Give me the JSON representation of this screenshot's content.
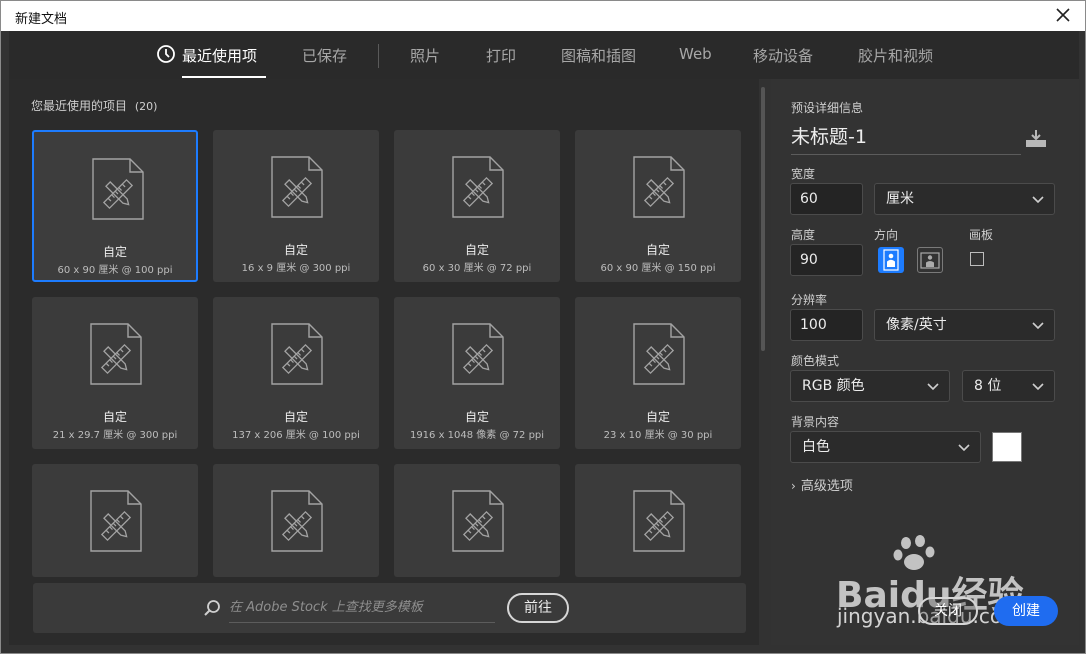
{
  "window": {
    "title": "新建文档"
  },
  "tabs": [
    {
      "label": "最近使用项",
      "active": true,
      "icon": "clock-icon"
    },
    {
      "label": "已保存"
    },
    {
      "label": "照片"
    },
    {
      "label": "打印"
    },
    {
      "label": "图稿和插图"
    },
    {
      "label": "Web"
    },
    {
      "label": "移动设备"
    },
    {
      "label": "胶片和视频"
    }
  ],
  "recent": {
    "label": "您最近使用的项目",
    "count": "(20)",
    "items": [
      {
        "name": "自定",
        "spec": "60 x 90 厘米 @ 100 ppi",
        "selected": true
      },
      {
        "name": "自定",
        "spec": "16 x 9 厘米 @ 300 ppi"
      },
      {
        "name": "自定",
        "spec": "60 x 30 厘米 @ 72 ppi"
      },
      {
        "name": "自定",
        "spec": "60 x 90 厘米 @ 150 ppi"
      },
      {
        "name": "自定",
        "spec": "21 x 29.7 厘米 @ 300 ppi"
      },
      {
        "name": "自定",
        "spec": "137 x 206 厘米 @ 100 ppi"
      },
      {
        "name": "自定",
        "spec": "1916 x 1048 像素 @ 72 ppi"
      },
      {
        "name": "自定",
        "spec": "23 x 10 厘米 @ 30 ppi"
      },
      {
        "name": "",
        "spec": ""
      },
      {
        "name": "",
        "spec": ""
      },
      {
        "name": "",
        "spec": ""
      },
      {
        "name": "",
        "spec": ""
      }
    ]
  },
  "stock": {
    "placeholder": "在 Adobe Stock 上查找更多模板",
    "go_label": "前往"
  },
  "preset": {
    "section_label": "预设详细信息",
    "doc_name": "未标题-1",
    "width_label": "宽度",
    "width_value": "60",
    "width_unit": "厘米",
    "height_label": "高度",
    "height_value": "90",
    "orientation_label": "方向",
    "artboard_label": "画板",
    "resolution_label": "分辨率",
    "resolution_value": "100",
    "resolution_unit": "像素/英寸",
    "color_mode_label": "颜色模式",
    "color_mode": "RGB 颜色",
    "bit_depth": "8 位",
    "background_label": "背景内容",
    "background": "白色",
    "background_color": "#ffffff",
    "advanced_label": "高级选项"
  },
  "buttons": {
    "close": "关闭",
    "create": "创建"
  },
  "watermark": {
    "brand": "Baidu经验",
    "url": "jingyan.baidu.com"
  },
  "colors": {
    "accent": "#1d7cff",
    "create": "#1f6cf0"
  }
}
